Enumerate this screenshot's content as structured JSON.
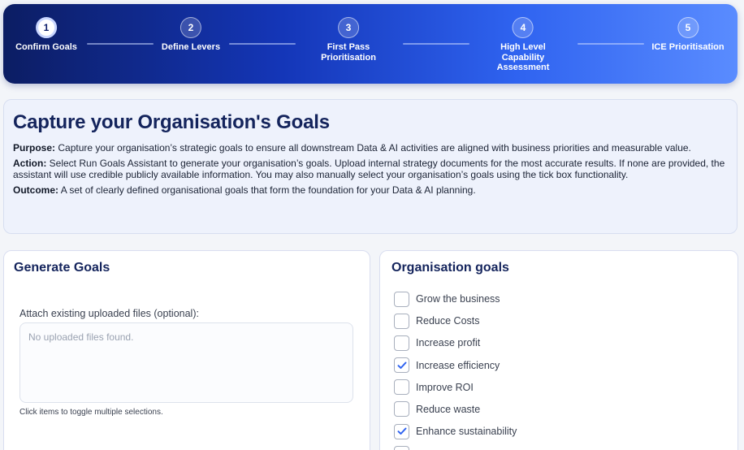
{
  "stepper": {
    "steps": [
      {
        "number": "1",
        "label": "Confirm Goals"
      },
      {
        "number": "2",
        "label": "Define Levers"
      },
      {
        "number": "3",
        "label": "First Pass\nPrioritisation"
      },
      {
        "number": "4",
        "label": "High Level\nCapability\nAssessment"
      },
      {
        "number": "5",
        "label": "ICE Prioritisation"
      }
    ],
    "active_step": 1
  },
  "intro": {
    "title": "Capture your Organisation's Goals",
    "purpose_label": "Purpose:",
    "purpose_text": " Capture your organisation’s strategic goals to ensure all downstream Data & AI activities are aligned with business priorities and measurable value.",
    "action_label": "Action:",
    "action_text": " Select Run Goals Assistant to generate your organisation’s goals. Upload internal strategy documents for the most accurate results. If none are provided, the assistant will use credible publicly available information. You may also manually select your organisation’s goals using the tick box functionality.",
    "outcome_label": "Outcome:",
    "outcome_text": " A set of clearly defined organisational goals that form the foundation for your Data & AI planning."
  },
  "generate": {
    "title": "Generate Goals",
    "attach_label": "Attach existing uploaded files (optional):",
    "empty_text": "No uploaded files found.",
    "hint": "Click items to toggle multiple selections."
  },
  "goals": {
    "title": "Organisation goals",
    "items": [
      {
        "label": "Grow the business",
        "checked": false
      },
      {
        "label": "Reduce Costs",
        "checked": false
      },
      {
        "label": "Increase profit",
        "checked": false
      },
      {
        "label": "Increase efficiency",
        "checked": true
      },
      {
        "label": "Improve ROI",
        "checked": false
      },
      {
        "label": "Reduce waste",
        "checked": false
      },
      {
        "label": "Enhance sustainability",
        "checked": true
      }
    ]
  },
  "colors": {
    "accent": "#1f4fd6",
    "title": "#14245c",
    "check": "#2f63f0"
  }
}
